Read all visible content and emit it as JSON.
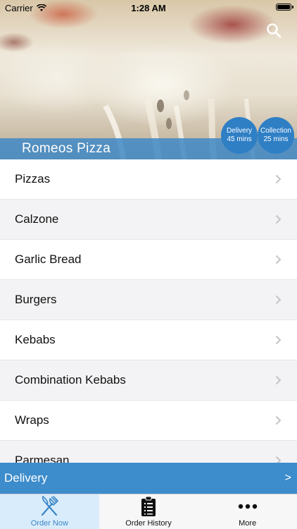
{
  "status_bar": {
    "carrier": "Carrier",
    "time": "1:28 AM"
  },
  "hero": {
    "restaurant_name": "Romeos Pizza",
    "delivery_badge": {
      "title": "Delivery",
      "time": "45 mins"
    },
    "collection_badge": {
      "title": "Collection",
      "time": "25 mins"
    },
    "search_icon": "search-icon"
  },
  "menu": {
    "items": [
      {
        "label": "Pizzas"
      },
      {
        "label": "Calzone"
      },
      {
        "label": "Garlic Bread"
      },
      {
        "label": "Burgers"
      },
      {
        "label": "Kebabs"
      },
      {
        "label": "Combination Kebabs"
      },
      {
        "label": "Wraps"
      },
      {
        "label": "Parmesan"
      }
    ]
  },
  "delivery_bar": {
    "label": "Delivery",
    "arrow": ">"
  },
  "tab_bar": {
    "tabs": [
      {
        "label": "Order Now",
        "icon": "fork-knife-icon",
        "active": true
      },
      {
        "label": "Order History",
        "icon": "clipboard-list-icon",
        "active": false
      },
      {
        "label": "More",
        "icon": "more-dots-icon",
        "active": false
      }
    ]
  },
  "colors": {
    "accent": "#3d8ccb",
    "badge": "#2f7fc5",
    "active_tab_bg": "#d9ecfb",
    "active_tab_text": "#3a86c8"
  }
}
